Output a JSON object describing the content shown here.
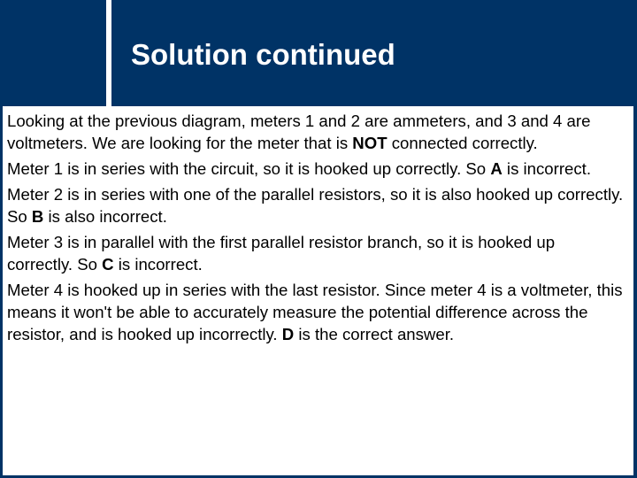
{
  "slide": {
    "title": "Solution continued",
    "colors": {
      "background": "#003366",
      "title_text": "#ffffff",
      "content_background": "#ffffff",
      "body_text": "#000000"
    },
    "paragraphs": [
      {
        "segments": [
          {
            "text": "Looking at the previous diagram, meters 1 and 2 are ammeters, and 3 and 4 are voltmeters. We are looking for the meter that is ",
            "bold": false
          },
          {
            "text": "NOT",
            "bold": true
          },
          {
            "text": " connected correctly.",
            "bold": false
          }
        ]
      },
      {
        "segments": [
          {
            "text": "Meter 1 is in series with the circuit, so it is hooked up correctly. So ",
            "bold": false
          },
          {
            "text": "A",
            "bold": true
          },
          {
            "text": " is incorrect.",
            "bold": false
          }
        ]
      },
      {
        "segments": [
          {
            "text": "Meter 2 is in series with one of the parallel resistors, so it is also hooked up correctly. So ",
            "bold": false
          },
          {
            "text": "B",
            "bold": true
          },
          {
            "text": " is also incorrect.",
            "bold": false
          }
        ]
      },
      {
        "segments": [
          {
            "text": "Meter 3 is in parallel with the first parallel resistor branch, so it is hooked up correctly. So ",
            "bold": false
          },
          {
            "text": "C",
            "bold": true
          },
          {
            "text": " is incorrect.",
            "bold": false
          }
        ]
      },
      {
        "segments": [
          {
            "text": "Meter 4 is hooked up in series with the last resistor. Since meter 4 is a voltmeter, this means it won't be able to accurately measure the potential difference across the resistor, and is hooked up incorrectly. ",
            "bold": false
          },
          {
            "text": "D",
            "bold": true
          },
          {
            "text": " is the correct answer.",
            "bold": false
          }
        ]
      }
    ]
  }
}
